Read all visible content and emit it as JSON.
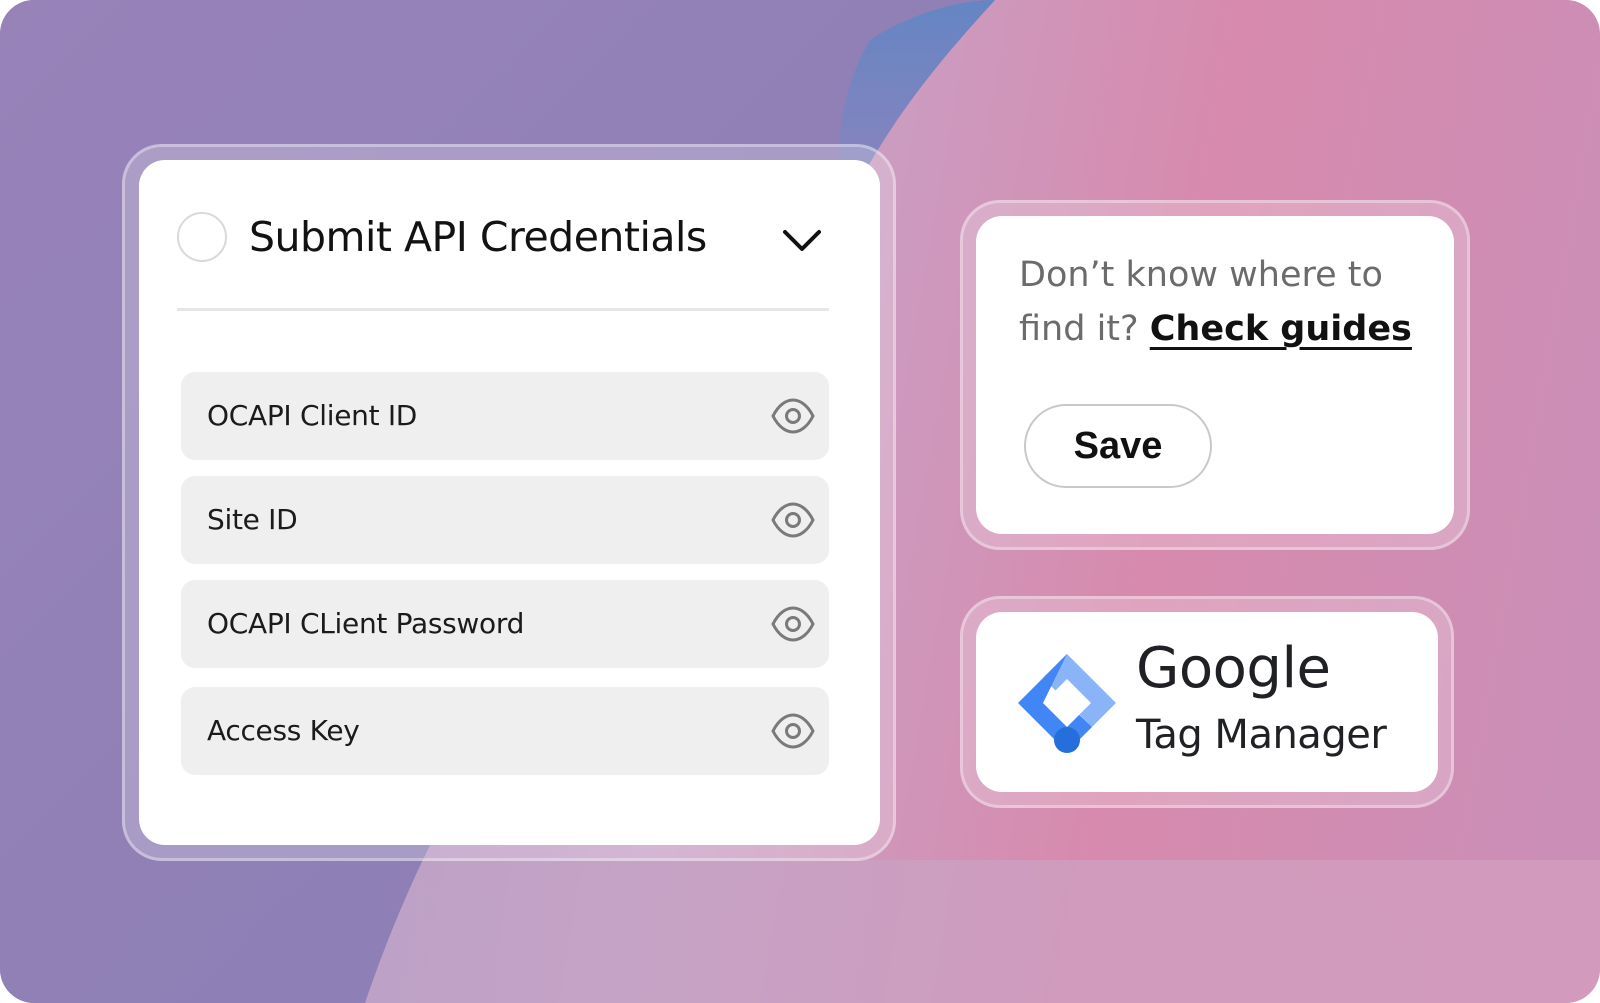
{
  "credentials_card": {
    "title": "Submit API Credentials",
    "status_icon": "empty-circle",
    "toggle_icon": "chevron-down-icon",
    "fields": [
      {
        "label": "OCAPI Client ID",
        "icon": "eye-icon"
      },
      {
        "label": "Site ID",
        "icon": "eye-icon"
      },
      {
        "label": "OCAPI CLient Password",
        "icon": "eye-icon"
      },
      {
        "label": "Access Key",
        "icon": "eye-icon"
      }
    ]
  },
  "guide_card": {
    "prompt": "Don’t know where to find it?",
    "link_label": "Check guides",
    "save_label": "Save"
  },
  "integration_card": {
    "brand": "Google",
    "product": "Tag Manager",
    "logo_colors": [
      "#8ab4f8",
      "#4285f4",
      "#246fdb"
    ]
  },
  "colors": {
    "background_left": "#9a84ba",
    "background_right": "#d78aad",
    "field_bg": "#efefef",
    "text_primary": "#121212",
    "text_secondary": "#6b6b6b"
  }
}
